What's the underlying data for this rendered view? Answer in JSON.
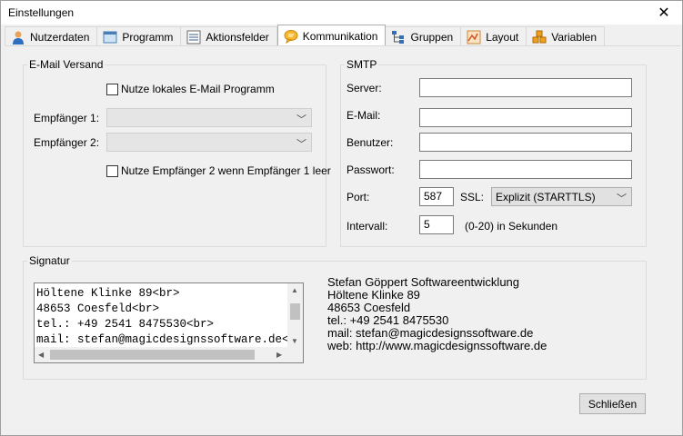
{
  "window": {
    "title": "Einstellungen",
    "close_glyph": "✕"
  },
  "tabs": [
    {
      "label": "Nutzerdaten",
      "icon": "user-icon"
    },
    {
      "label": "Programm",
      "icon": "window-icon"
    },
    {
      "label": "Aktionsfelder",
      "icon": "list-icon"
    },
    {
      "label": "Kommunikation",
      "icon": "speech-bubble-icon",
      "active": true
    },
    {
      "label": "Gruppen",
      "icon": "tree-icon"
    },
    {
      "label": "Layout",
      "icon": "layout-icon"
    },
    {
      "label": "Variablen",
      "icon": "cubes-icon"
    }
  ],
  "email": {
    "group_title": "E-Mail Versand",
    "use_local_label": "Nutze lokales E-Mail Programm",
    "use_local_checked": false,
    "recipient1_label": "Empfänger 1:",
    "recipient1_value": "",
    "recipient2_label": "Empfänger 2:",
    "recipient2_value": "",
    "use_r2_label": "Nutze Empfänger 2 wenn Empfänger 1 leer",
    "use_r2_checked": false
  },
  "smtp": {
    "group_title": "SMTP",
    "server_label": "Server:",
    "server_value": "",
    "email_label": "E-Mail:",
    "email_value": "",
    "user_label": "Benutzer:",
    "user_value": "",
    "password_label": "Passwort:",
    "password_value": "",
    "port_label": "Port:",
    "port_value": "587",
    "ssl_label": "SSL:",
    "ssl_value": "Explizit (STARTTLS)",
    "interval_label": "Intervall:",
    "interval_value": "5",
    "interval_hint": "(0-20) in Sekunden"
  },
  "signature": {
    "group_title": "Signatur",
    "source": "Höltene Klinke 89<br>\n48653 Coesfeld<br>\ntel.: +49 2541 8475530<br>\nmail: stefan@magicdesignssoftware.de<br>",
    "preview": [
      "Stefan Göppert Softwareentwicklung",
      "Höltene Klinke 89",
      "48653 Coesfeld",
      "tel.: +49 2541 8475530",
      "mail: stefan@magicdesignssoftware.de",
      "web: http://www.magicdesignssoftware.de"
    ]
  },
  "footer": {
    "close_label": "Schließen"
  }
}
